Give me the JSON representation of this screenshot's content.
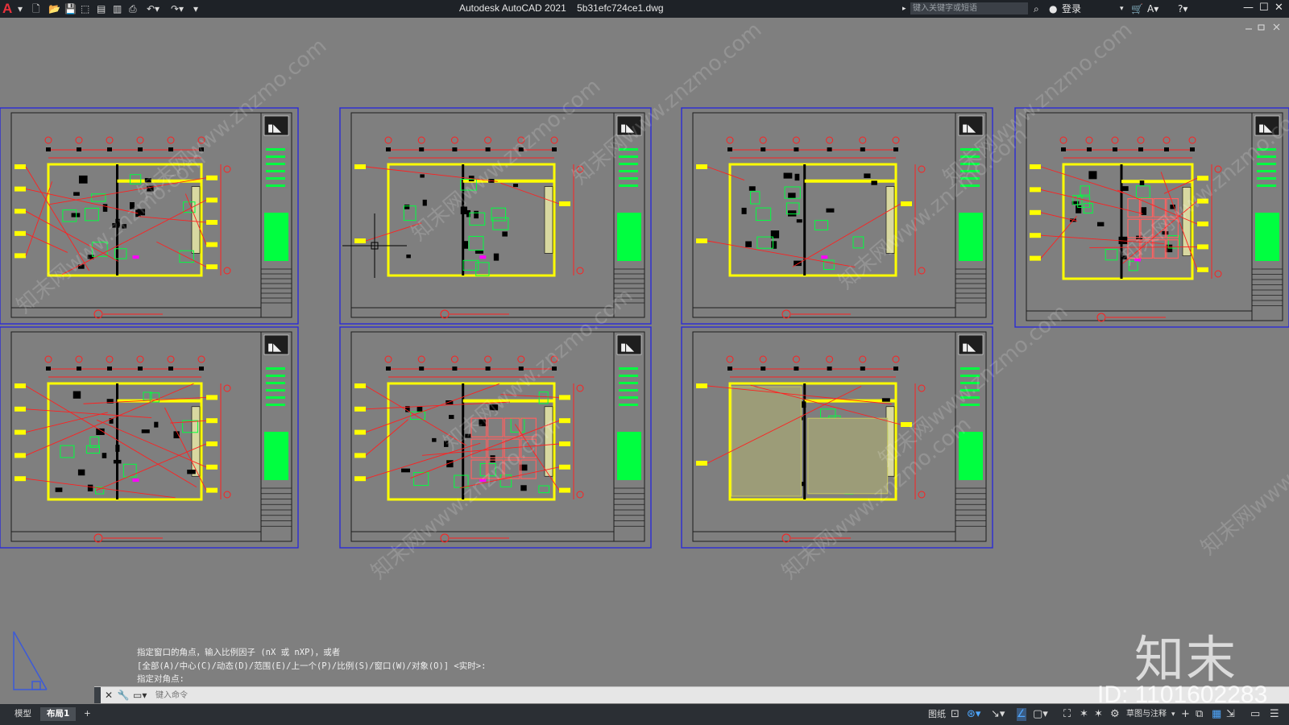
{
  "window": {
    "app_title": "Autodesk AutoCAD 2021",
    "file_name": "5b31efc724ce1.dwg",
    "search_placeholder": "键入关键字或短语",
    "login_label": "登录"
  },
  "command": {
    "history": [
      "指定窗口的角点，输入比例因子 (nX 或 nXP)，或者",
      "[全部(A)/中心(C)/动态(D)/范围(E)/上一个(P)/比例(S)/窗口(W)/对象(O)] <实时>:",
      "指定对角点:"
    ],
    "input_placeholder": "键入命令"
  },
  "layout_tabs": [
    {
      "label": "模型",
      "active": false
    },
    {
      "label": "布局1",
      "active": true
    }
  ],
  "add_tab_label": "+",
  "status": {
    "paper_label": "图纸",
    "workspace_label": "草图与注释"
  },
  "watermark": {
    "brand": "知末",
    "id": "ID: 1101602283",
    "repeat": "知末网www.znzmo.com"
  },
  "colors": {
    "background": "#7f7f7f",
    "frame": "#2b2bd6",
    "linework_yellow": "#ffff00",
    "linework_red": "#ff2020",
    "linework_green": "#00ff40",
    "accent_magenta": "#ff00ff"
  }
}
